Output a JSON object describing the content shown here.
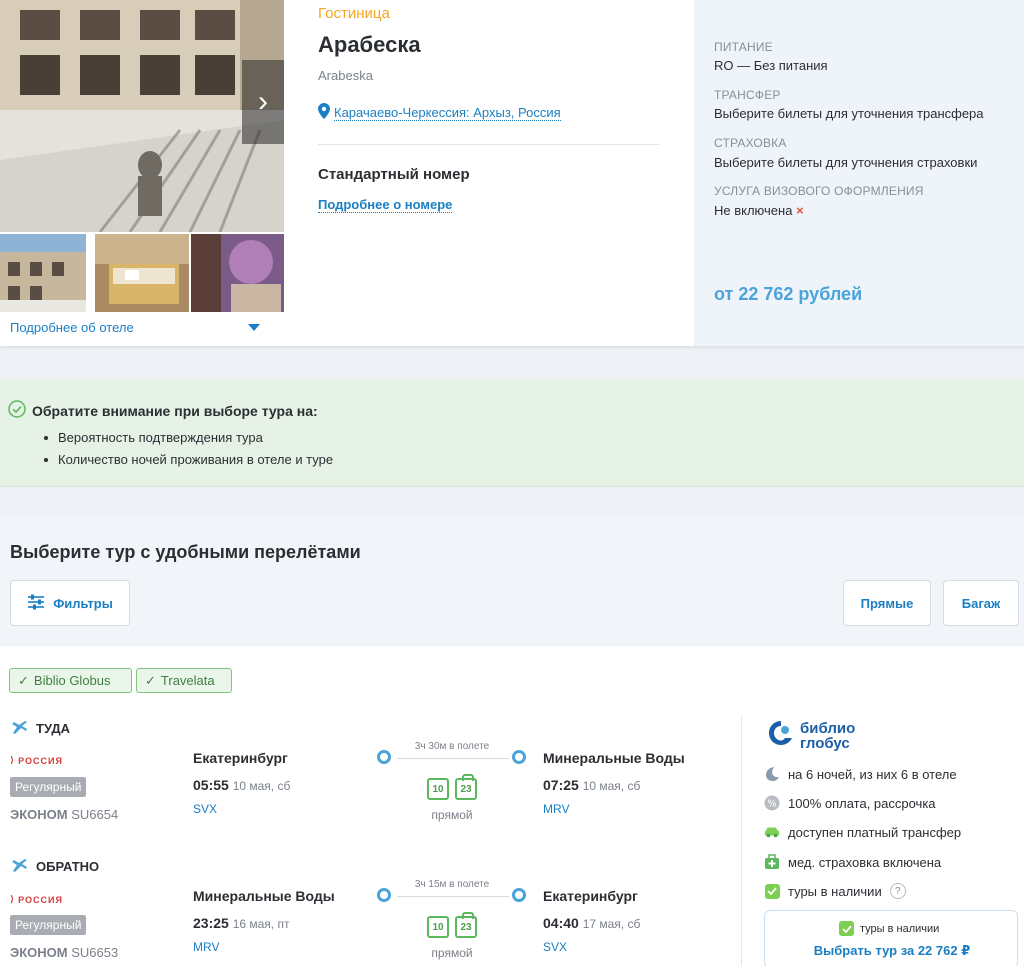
{
  "hotel": {
    "type": "Гостиница",
    "name": "Арабеска",
    "name_latin": "Arabeska",
    "location": "Карачаево-Черкессия: Архыз, Россия",
    "room": "Стандартный номер",
    "room_more": "Подробнее о номере",
    "more_hotel": "Подробнее об отеле"
  },
  "details": {
    "meal_label": "ПИТАНИЕ",
    "meal_value": "RO — Без питания",
    "transfer_label": "ТРАНСФЕР",
    "transfer_value": "Выберите билеты для уточнения трансфера",
    "insurance_label": "СТРАХОВКА",
    "insurance_value": "Выберите билеты для уточнения страховки",
    "visa_label": "УСЛУГА ВИЗОВОГО ОФОРМЛЕНИЯ",
    "visa_value": "Не включена",
    "price": "от 22 762 рублей"
  },
  "notice": {
    "title": "Обратите внимание при выборе тура на:",
    "items": [
      "Вероятность подтверждения тура",
      "Количество ночей проживания в отеле и туре"
    ]
  },
  "flights": {
    "title": "Выберите тур с удобными перелётами",
    "filters": "Фильтры",
    "direct": "Прямые",
    "baggage": "Багаж",
    "tags": [
      "Biblio Globus",
      "Travelata"
    ]
  },
  "outbound": {
    "title": "ТУДА",
    "airline": "РОССИЯ",
    "regular": "Регулярный",
    "cabin": "ЭКОНОМ",
    "flight": "SU6654",
    "from_city": "Екатеринбург",
    "dep_time": "05:55",
    "dep_date": "10 мая, сб",
    "from_code": "SVX",
    "duration": "3ч 30м в полете",
    "bag_hand": "10",
    "bag_check": "23",
    "direct": "прямой",
    "to_city": "Минеральные Воды",
    "arr_time": "07:25",
    "arr_date": "10 мая, сб",
    "to_code": "MRV"
  },
  "return": {
    "title": "ОБРАТНО",
    "airline": "РОССИЯ",
    "regular": "Регулярный",
    "cabin": "ЭКОНОМ",
    "flight": "SU6653",
    "from_city": "Минеральные Воды",
    "dep_time": "23:25",
    "dep_date": "16 мая, пт",
    "from_code": "MRV",
    "duration": "3ч 15м в полете",
    "bag_hand": "10",
    "bag_check": "23",
    "direct": "прямой",
    "to_city": "Екатеринбург",
    "arr_time": "04:40",
    "arr_date": "17 мая, сб",
    "to_code": "SVX"
  },
  "operator": {
    "logo_line1": "библио",
    "logo_line2": "глобус",
    "nights": "на 6 ночей, из них 6 в отеле",
    "payment": "100% оплата, рассрочка",
    "transfer": "доступен платный трансфер",
    "insurance": "мед. страховка включена",
    "availability": "туры в наличии",
    "help": "?",
    "box_availability": "туры в наличии",
    "select": "Выбрать тур за 22 762 ₽"
  },
  "colors": {
    "accent": "#1a7fc4",
    "price": "#4aa3d9",
    "orange": "#f5a623",
    "green": "#7ccf52",
    "red": "#e8533f"
  }
}
